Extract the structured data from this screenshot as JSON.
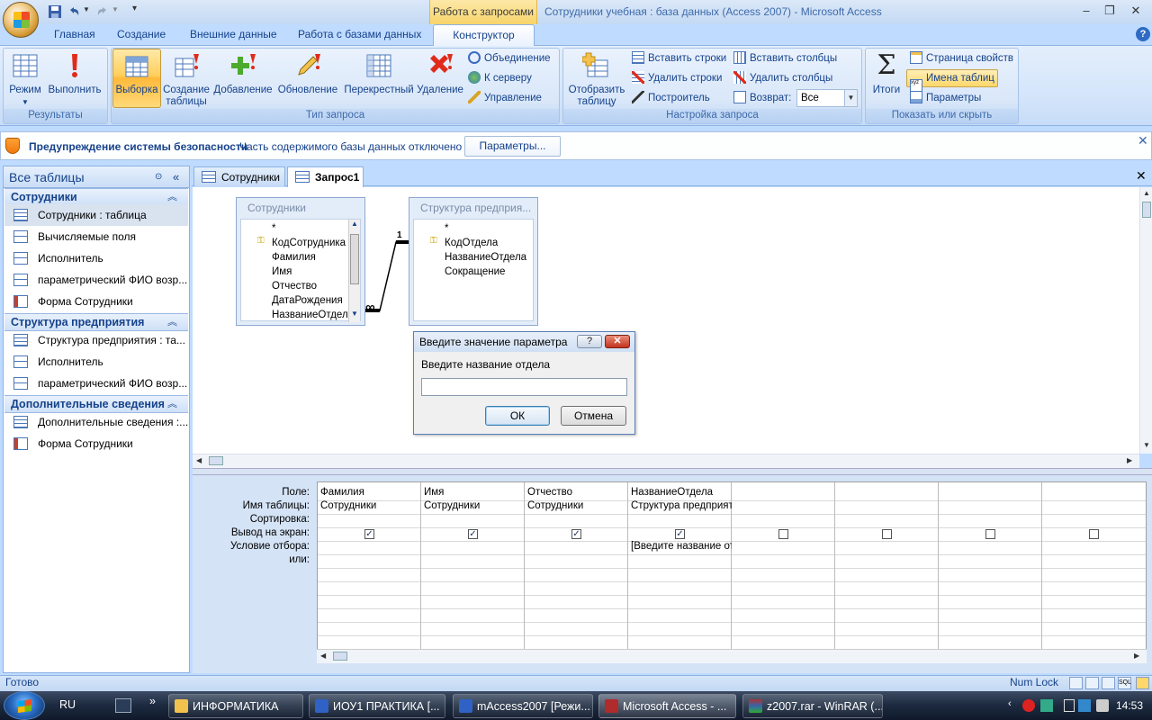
{
  "window": {
    "title": "Сотрудники учебная : база данных (Access 2007) - Microsoft Access",
    "context_tab": "Работа с запросами"
  },
  "ribbon_tabs": [
    "Главная",
    "Создание",
    "Внешние данные",
    "Работа с базами данных",
    "Конструктор"
  ],
  "groups": {
    "results": {
      "label": "Результаты",
      "mode": "Режим",
      "run": "Выполнить"
    },
    "query_type": {
      "label": "Тип запроса",
      "select": "Выборка",
      "make_table_1": "Создание",
      "make_table_2": "таблицы",
      "append": "Добавление",
      "update": "Обновление",
      "crosstab": "Перекрестный",
      "delete": "Удаление",
      "union": "Объединение",
      "pass_through": "К серверу",
      "data_definition": "Управление"
    },
    "query_setup": {
      "label": "Настройка запроса",
      "show_table_1": "Отобразить",
      "show_table_2": "таблицу",
      "insert_rows": "Вставить строки",
      "delete_rows": "Удалить строки",
      "builder": "Построитель",
      "insert_columns": "Вставить столбцы",
      "delete_columns": "Удалить столбцы",
      "return_label": "Возврат:",
      "return_value": "Все"
    },
    "show_hide": {
      "label": "Показать или скрыть",
      "totals": "Итоги",
      "property_sheet": "Страница свойств",
      "table_names": "Имена таблиц",
      "parameters": "Параметры"
    }
  },
  "security": {
    "title": "Предупреждение системы безопасности",
    "message": "Часть содержимого базы данных отключено",
    "button": "Параметры..."
  },
  "nav": {
    "header": "Все таблицы",
    "groups": [
      {
        "title": "Сотрудники",
        "items": [
          "Сотрудники : таблица",
          "Вычисляемые поля",
          "Исполнитель",
          "параметрический ФИО возр...",
          "Форма Сотрудники"
        ]
      },
      {
        "title": "Структура предприятия",
        "items": [
          "Структура предприятия : та...",
          "Исполнитель",
          "параметрический ФИО возр..."
        ]
      },
      {
        "title": "Дополнительные сведения",
        "items": [
          "Дополнительные сведения :...",
          "Форма Сотрудники"
        ]
      }
    ]
  },
  "doc_tabs": [
    "Сотрудники",
    "Запрос1"
  ],
  "tables": {
    "t1": {
      "title": "Сотрудники",
      "fields": [
        "*",
        "КодСотрудника",
        "Фамилия",
        "Имя",
        "Отчество",
        "ДатаРождения",
        "НазваниеОтдел"
      ]
    },
    "t2": {
      "title": "Структура предприя...",
      "fields": [
        "*",
        "КодОтдела",
        "НазваниеОтдела",
        "Сокращение"
      ]
    },
    "rel_one": "1",
    "rel_many": "∞"
  },
  "grid": {
    "row_labels": [
      "Поле:",
      "Имя таблицы:",
      "Сортировка:",
      "Вывод на экран:",
      "Условие отбора:",
      "или:"
    ],
    "columns": [
      {
        "field": "Фамилия",
        "table": "Сотрудники",
        "show": true,
        "criteria": ""
      },
      {
        "field": "Имя",
        "table": "Сотрудники",
        "show": true,
        "criteria": ""
      },
      {
        "field": "Отчество",
        "table": "Сотрудники",
        "show": true,
        "criteria": ""
      },
      {
        "field": "НазваниеОтдела",
        "table": "Структура предприят",
        "show": true,
        "criteria": "[Введите название от"
      },
      {
        "field": "",
        "table": "",
        "show": false,
        "criteria": ""
      },
      {
        "field": "",
        "table": "",
        "show": false,
        "criteria": ""
      },
      {
        "field": "",
        "table": "",
        "show": false,
        "criteria": ""
      },
      {
        "field": "",
        "table": "",
        "show": false,
        "criteria": ""
      }
    ]
  },
  "dialog": {
    "title": "Введите значение параметра",
    "prompt": "Введите название отдела",
    "value": "",
    "ok": "ОК",
    "cancel": "Отмена"
  },
  "status": {
    "ready": "Готово",
    "numlock": "Num Lock"
  },
  "taskbar": {
    "lang": "RU",
    "tasks": [
      "ИНФОРМАТИКА",
      "ИОУ1 ПРАКТИКА [...",
      "mAccess2007 [Режи...",
      "Microsoft Access - ...",
      "z2007.rar - WinRAR (..."
    ],
    "clock": "14:53"
  }
}
